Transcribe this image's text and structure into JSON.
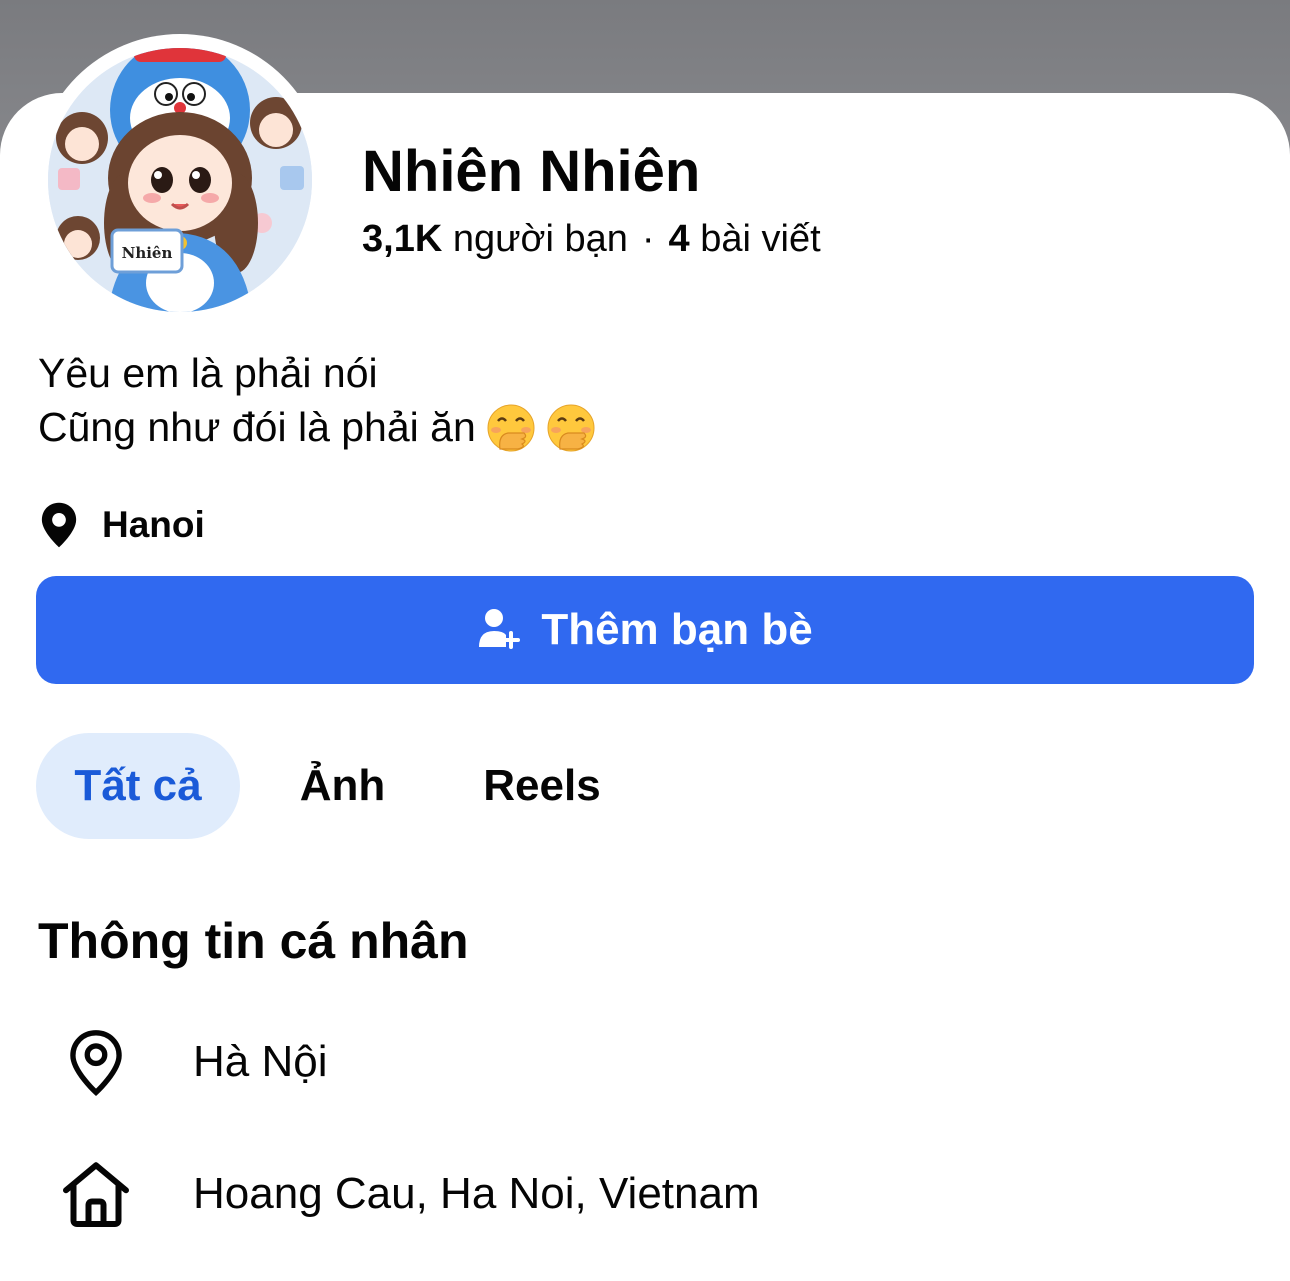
{
  "profile": {
    "name": "Nhiên Nhiên",
    "friends_count": "3,1K",
    "friends_label": "người bạn",
    "separator": "·",
    "posts_count": "4",
    "posts_label": "bài viết",
    "avatar_badge_text": "Nhiên"
  },
  "bio": {
    "line1": "Yêu em là phải nói",
    "line2": "Cũng như đói là phải ăn",
    "emoji": [
      "face-with-hand-over-mouth",
      "face-with-hand-over-mouth"
    ]
  },
  "location": {
    "icon": "location-pin-icon",
    "label": "Hanoi"
  },
  "add_friend_button": {
    "icon": "person-add-icon",
    "label": "Thêm bạn bè",
    "color": "#3069f0"
  },
  "tabs": [
    {
      "label": "Tất cả",
      "active": true
    },
    {
      "label": "Ảnh",
      "active": false
    },
    {
      "label": "Reels",
      "active": false
    }
  ],
  "personal_info": {
    "title": "Thông tin cá nhân",
    "items": [
      {
        "icon": "location-pin-outline-icon",
        "text": "Hà Nội"
      },
      {
        "icon": "home-icon",
        "text": "Hoang Cau, Ha Noi, Vietnam"
      }
    ]
  },
  "colors": {
    "accent": "#3069f0",
    "active_tab_bg": "#e0ecfc",
    "active_tab_text": "#1a5ad8"
  }
}
